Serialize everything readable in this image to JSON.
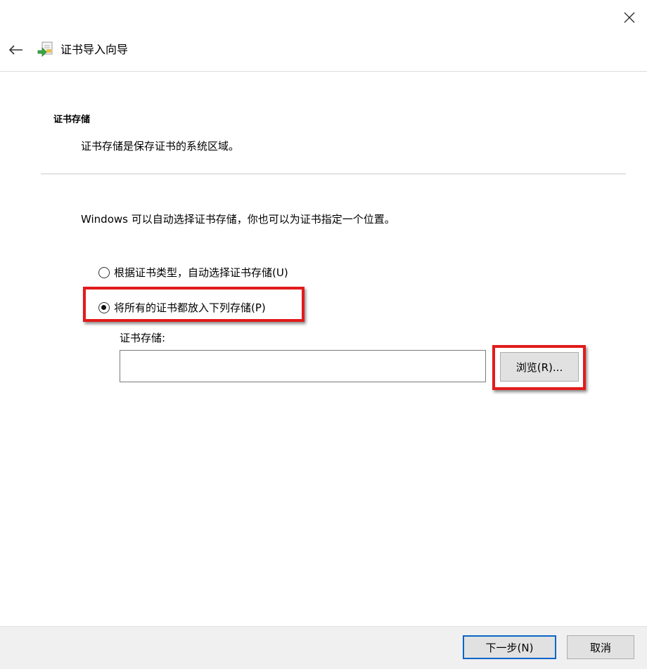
{
  "window": {
    "title": "证书导入向导"
  },
  "header": {
    "section_title": "证书存储",
    "section_description": "证书存储是保存证书的系统区域。"
  },
  "body": {
    "intro": "Windows 可以自动选择证书存储，你也可以为证书指定一个位置。",
    "options": [
      {
        "label": "根据证书类型，自动选择证书存储(U)",
        "selected": false
      },
      {
        "label": "将所有的证书都放入下列存储(P)",
        "selected": true
      }
    ],
    "store_field": {
      "label": "证书存储:",
      "value": ""
    },
    "browse_label": "浏览(R)..."
  },
  "footer": {
    "next_label": "下一步(N)",
    "cancel_label": "取消"
  },
  "colors": {
    "highlight": "#e21b1b",
    "default_button_border": "#0a64c8",
    "footer_bg": "#f0f0f0"
  },
  "icons": {
    "close": "close-icon",
    "back": "back-arrow-icon",
    "wizard": "certificate-wizard-icon"
  }
}
